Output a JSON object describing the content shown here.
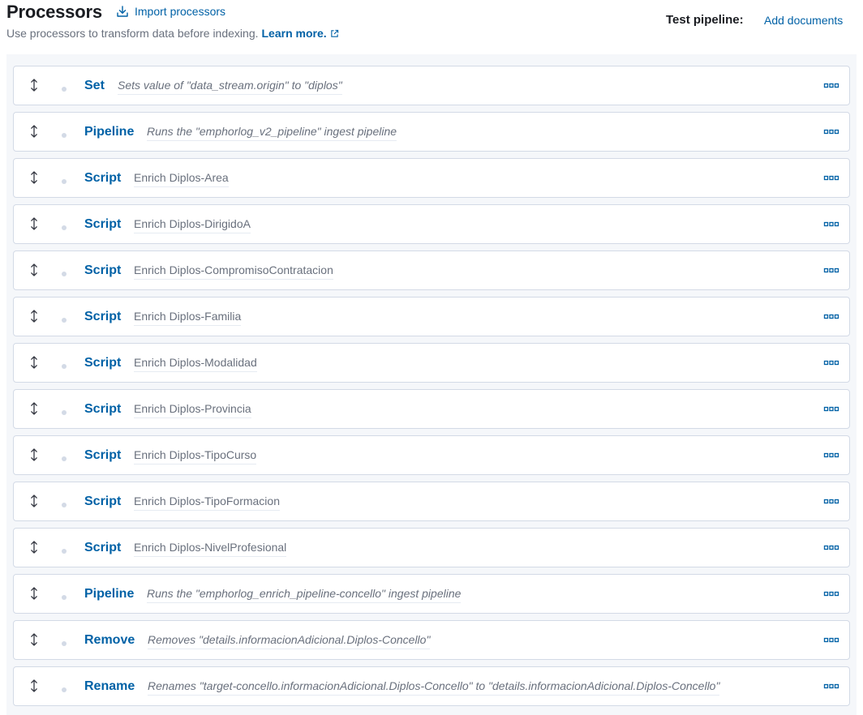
{
  "header": {
    "title": "Processors",
    "import_label": "Import processors",
    "subtitle": "Use processors to transform data before indexing.",
    "learn_more": "Learn more.",
    "test_pipeline_label": "Test pipeline:",
    "add_documents_label": "Add documents"
  },
  "processors": [
    {
      "type": "Set",
      "description": "Sets value of \"data_stream.origin\" to \"diplos\"",
      "italic": true
    },
    {
      "type": "Pipeline",
      "description": "Runs the \"emphorlog_v2_pipeline\" ingest pipeline",
      "italic": true
    },
    {
      "type": "Script",
      "description": "Enrich Diplos-Area",
      "italic": false
    },
    {
      "type": "Script",
      "description": "Enrich Diplos-DirigidoA",
      "italic": false
    },
    {
      "type": "Script",
      "description": "Enrich Diplos-CompromisoContratacion",
      "italic": false
    },
    {
      "type": "Script",
      "description": "Enrich Diplos-Familia",
      "italic": false
    },
    {
      "type": "Script",
      "description": "Enrich Diplos-Modalidad",
      "italic": false
    },
    {
      "type": "Script",
      "description": "Enrich Diplos-Provincia",
      "italic": false
    },
    {
      "type": "Script",
      "description": "Enrich Diplos-TipoCurso",
      "italic": false
    },
    {
      "type": "Script",
      "description": "Enrich Diplos-TipoFormacion",
      "italic": false
    },
    {
      "type": "Script",
      "description": "Enrich Diplos-NivelProfesional",
      "italic": false
    },
    {
      "type": "Pipeline",
      "description": "Runs the \"emphorlog_enrich_pipeline-concello\" ingest pipeline",
      "italic": true
    },
    {
      "type": "Remove",
      "description": "Removes \"details.informacionAdicional.Diplos-Concello\"",
      "italic": true
    },
    {
      "type": "Rename",
      "description": "Renames \"target-concello.informacionAdicional.Diplos-Concello\" to \"details.informacionAdicional.Diplos-Concello\"",
      "italic": true
    }
  ],
  "icons": {
    "import": "import-icon",
    "external_link": "external-link-icon",
    "drag": "drag-handle-icon",
    "more": "more-actions-icon"
  },
  "colors": {
    "link": "#0061a6",
    "title": "#1a1c21",
    "subdued": "#69707d",
    "border": "#d3dae6",
    "panel_bg": "#f5f7fa"
  }
}
